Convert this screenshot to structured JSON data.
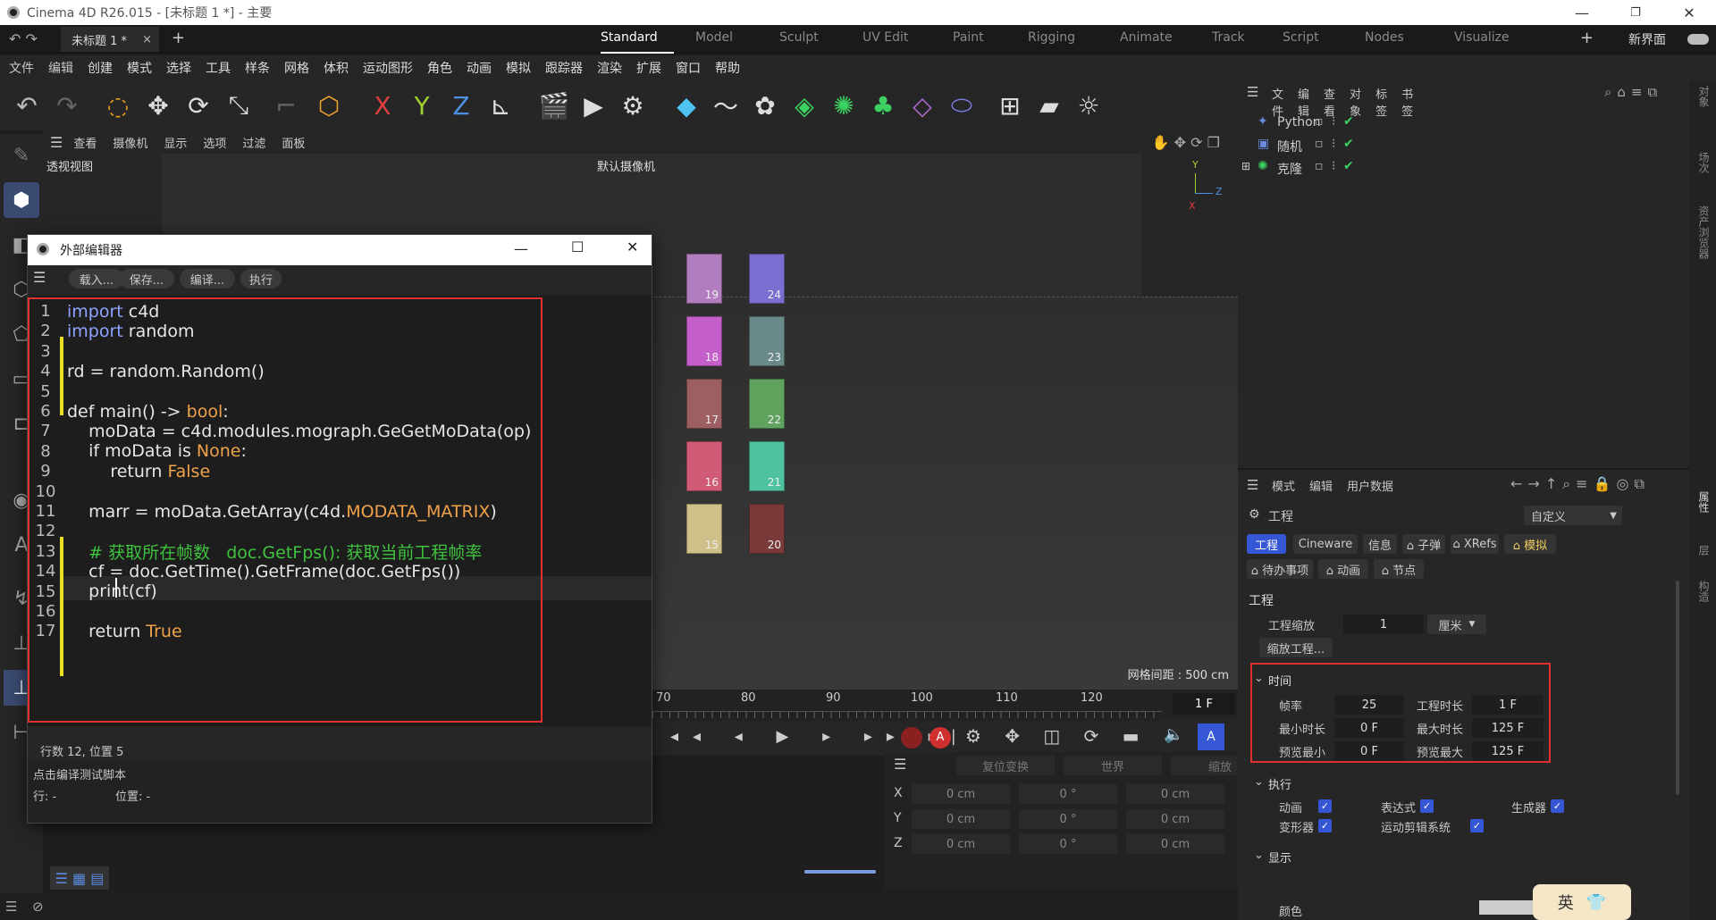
{
  "window": {
    "title": "Cinema 4D R26.015 - [未标题 1 *] - 主要",
    "minimize": "—",
    "restore": "❐",
    "close": "✕"
  },
  "tabs": {
    "doc": "未标题 1 *",
    "doc_close": "×",
    "add": "+",
    "layouts": [
      "Standard",
      "Model",
      "Sculpt",
      "UV Edit",
      "Paint",
      "Rigging",
      "Animate",
      "Track",
      "Script",
      "Nodes",
      "Visualize"
    ],
    "active_layout": "Standard",
    "new_ui": "新界面",
    "add_layout": "+"
  },
  "menu": [
    "文件",
    "编辑",
    "创建",
    "模式",
    "选择",
    "工具",
    "样条",
    "网格",
    "体积",
    "运动图形",
    "角色",
    "动画",
    "模拟",
    "跟踪器",
    "渲染",
    "扩展",
    "窗口",
    "帮助"
  ],
  "viewport": {
    "menu": [
      "查看",
      "摄像机",
      "显示",
      "选项",
      "过滤",
      "面板"
    ],
    "name": "透视视图",
    "camera": "默认摄像机",
    "grid_spacing": "网格间距 : 500 cm",
    "axis_y": "Y",
    "axis_z": "Z",
    "axis_x": "X"
  },
  "cubes": [
    {
      "n": "19",
      "color": "#b17dbf"
    },
    {
      "n": "24",
      "color": "#7a6fd0"
    },
    {
      "n": "18",
      "color": "#c45fc9"
    },
    {
      "n": "23",
      "color": "#6a8a8a"
    },
    {
      "n": "17",
      "color": "#9d5f62"
    },
    {
      "n": "22",
      "color": "#5fa35f"
    },
    {
      "n": "16",
      "color": "#d15a76"
    },
    {
      "n": "21",
      "color": "#4fc3a0"
    },
    {
      "n": "15",
      "color": "#cfc08a"
    },
    {
      "n": "20",
      "color": "#7a3a3a"
    }
  ],
  "timeline": {
    "ticks": [
      "70",
      "80",
      "90",
      "100",
      "110",
      "120"
    ],
    "frame": "1 F"
  },
  "coords": {
    "headers": [
      "复位变换",
      "世界",
      "缩放"
    ],
    "rows": [
      {
        "axis": "X",
        "pos": "0 cm",
        "rot": "0 °",
        "scale": "0 cm"
      },
      {
        "axis": "Y",
        "pos": "0 cm",
        "rot": "0 °",
        "scale": "0 cm"
      },
      {
        "axis": "Z",
        "pos": "0 cm",
        "rot": "0 °",
        "scale": "0 cm"
      }
    ]
  },
  "editor": {
    "title": "外部编辑器",
    "buttons": [
      "载入...",
      "保存...",
      "编译...",
      "执行"
    ],
    "lines": [
      {
        "n": "1",
        "parts": [
          {
            "t": "import",
            "c": "kw"
          },
          {
            "t": " c4d",
            "c": ""
          }
        ]
      },
      {
        "n": "2",
        "parts": [
          {
            "t": "import",
            "c": "kw"
          },
          {
            "t": " random",
            "c": ""
          }
        ]
      },
      {
        "n": "3",
        "parts": []
      },
      {
        "n": "4",
        "parts": [
          {
            "t": "rd = random.Random()",
            "c": ""
          }
        ]
      },
      {
        "n": "5",
        "parts": []
      },
      {
        "n": "6",
        "parts": [
          {
            "t": "def main() -> ",
            "c": ""
          },
          {
            "t": "bool",
            "c": "num"
          },
          {
            "t": ":",
            "c": ""
          }
        ]
      },
      {
        "n": "7",
        "parts": [
          {
            "t": "    moData = c4d.modules.mograph.GeGetMoData(op)",
            "c": ""
          }
        ]
      },
      {
        "n": "8",
        "parts": [
          {
            "t": "    if moData is ",
            "c": ""
          },
          {
            "t": "None",
            "c": "num"
          },
          {
            "t": ":",
            "c": ""
          }
        ]
      },
      {
        "n": "9",
        "parts": [
          {
            "t": "        return ",
            "c": ""
          },
          {
            "t": "False",
            "c": "num"
          }
        ]
      },
      {
        "n": "10",
        "parts": []
      },
      {
        "n": "11",
        "parts": [
          {
            "t": "    marr = moData.GetArray(c4d.",
            "c": ""
          },
          {
            "t": "MODATA_MATRIX",
            "c": "num"
          },
          {
            "t": ")",
            "c": ""
          }
        ]
      },
      {
        "n": "12",
        "parts": [
          {
            "t": "    ",
            "c": ""
          }
        ]
      },
      {
        "n": "13",
        "parts": [
          {
            "t": "    # 获取所在帧数   doc.GetFps(): 获取当前工程帧率",
            "c": "cm"
          }
        ]
      },
      {
        "n": "14",
        "parts": [
          {
            "t": "    cf = doc.GetTime().GetFrame(doc.GetFps())",
            "c": ""
          }
        ]
      },
      {
        "n": "15",
        "parts": [
          {
            "t": "    print(cf)",
            "c": ""
          }
        ]
      },
      {
        "n": "16",
        "parts": []
      },
      {
        "n": "17",
        "parts": [
          {
            "t": "    return ",
            "c": ""
          },
          {
            "t": "True",
            "c": "num"
          }
        ]
      }
    ],
    "status": "行数 12, 位置 5",
    "hint": "点击编译测试脚本",
    "row_label": "行: -",
    "pos_label": "位置: -"
  },
  "objects": {
    "menu": [
      "文件",
      "编辑",
      "查看",
      "对象",
      "标签",
      "书签"
    ],
    "items": [
      {
        "name": "Python",
        "icon": "python-icon"
      },
      {
        "name": "随机",
        "icon": "random-icon"
      },
      {
        "name": "克隆",
        "icon": "cloner-icon"
      }
    ]
  },
  "attributes": {
    "menu": [
      "模式",
      "编辑",
      "用户数据"
    ],
    "header": "工程",
    "preset": "自定义",
    "tabs": [
      "工程",
      "Cineware",
      "信息",
      "子弹",
      "XRefs",
      "模拟"
    ],
    "tabs2": [
      "待办事项",
      "动画",
      "节点"
    ],
    "section": "工程",
    "scale_label": "工程缩放",
    "scale_value": "1",
    "unit": "厘米",
    "scale_btn": "缩放工程...",
    "time": {
      "title": "时间",
      "fps_label": "帧率",
      "fps": "25",
      "duration_label": "工程时长",
      "duration": "1 F",
      "min_label": "最小时长",
      "min": "0 F",
      "max_label": "最大时长",
      "max": "125 F",
      "pmin_label": "预览最小",
      "pmin": "0 F",
      "pmax_label": "预览最大",
      "pmax": "125 F"
    },
    "exec": {
      "title": "执行",
      "items": [
        "动画",
        "表达式",
        "生成器",
        "变形器",
        "运动剪辑系统"
      ]
    },
    "display": {
      "title": "显示",
      "color_label": "颜色"
    }
  },
  "side_tabs": [
    "对象",
    "场次",
    "资产浏览器",
    "属性",
    "层",
    "构造"
  ],
  "ime": {
    "lang": "英"
  }
}
